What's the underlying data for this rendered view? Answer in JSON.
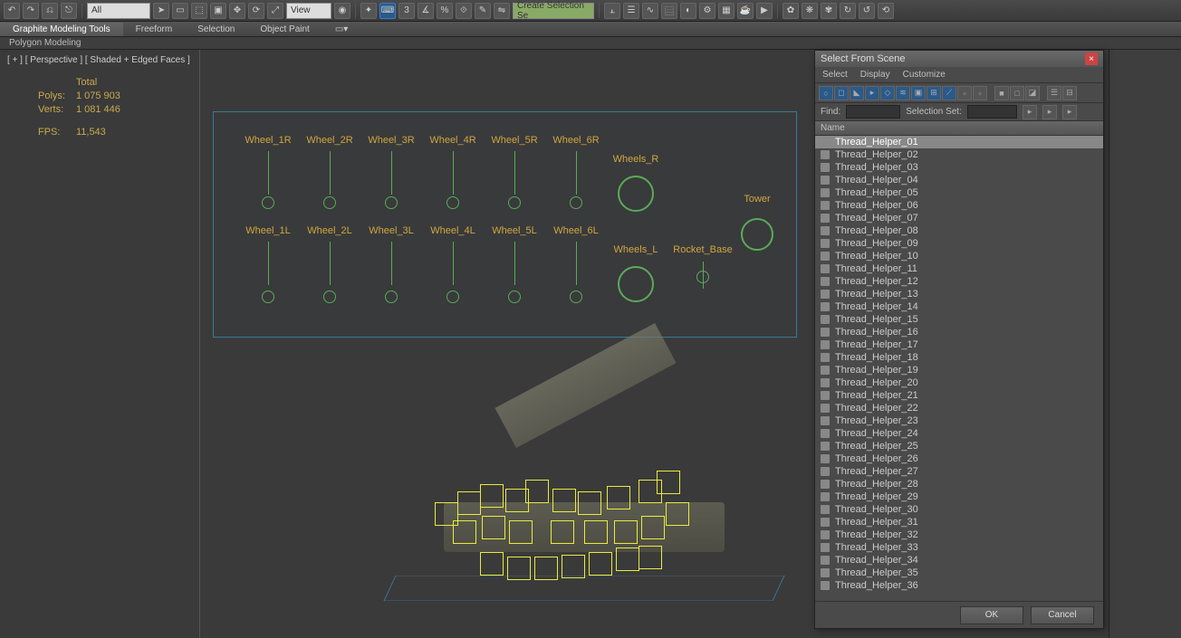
{
  "toolbar": {
    "dropdown_all": "All",
    "dropdown_view": "View",
    "selection_set_ph": "Create Selection Se"
  },
  "ribbon": {
    "tabs": [
      "Graphite Modeling Tools",
      "Freeform",
      "Selection",
      "Object Paint"
    ],
    "sub": "Polygon Modeling"
  },
  "viewport": {
    "label": "[ + ] [ Perspective ] [ Shaded + Edged Faces ]",
    "stats_header": "Total",
    "polys_label": "Polys:",
    "polys_value": "1 075 903",
    "verts_label": "Verts:",
    "verts_value": "1 081 446",
    "fps_label": "FPS:",
    "fps_value": "11,543"
  },
  "rig": {
    "rowR": [
      "Wheel_1R",
      "Wheel_2R",
      "Wheel_3R",
      "Wheel_4R",
      "Wheel_5R",
      "Wheel_6R"
    ],
    "rowL": [
      "Wheel_1L",
      "Wheel_2L",
      "Wheel_3L",
      "Wheel_4L",
      "Wheel_5L",
      "Wheel_6L"
    ],
    "wheels_r": "Wheels_R",
    "wheels_l": "Wheels_L",
    "tower": "Tower",
    "rocket": "Rocket_Base"
  },
  "dialog": {
    "title": "Select From Scene",
    "menu": [
      "Select",
      "Display",
      "Customize"
    ],
    "find_label": "Find:",
    "selset_label": "Selection Set:",
    "col_name": "Name",
    "ok": "OK",
    "cancel": "Cancel",
    "items": [
      "Thread_Helper_01",
      "Thread_Helper_02",
      "Thread_Helper_03",
      "Thread_Helper_04",
      "Thread_Helper_05",
      "Thread_Helper_06",
      "Thread_Helper_07",
      "Thread_Helper_08",
      "Thread_Helper_09",
      "Thread_Helper_10",
      "Thread_Helper_11",
      "Thread_Helper_12",
      "Thread_Helper_13",
      "Thread_Helper_14",
      "Thread_Helper_15",
      "Thread_Helper_16",
      "Thread_Helper_17",
      "Thread_Helper_18",
      "Thread_Helper_19",
      "Thread_Helper_20",
      "Thread_Helper_21",
      "Thread_Helper_22",
      "Thread_Helper_23",
      "Thread_Helper_24",
      "Thread_Helper_25",
      "Thread_Helper_26",
      "Thread_Helper_27",
      "Thread_Helper_28",
      "Thread_Helper_29",
      "Thread_Helper_30",
      "Thread_Helper_31",
      "Thread_Helper_32",
      "Thread_Helper_33",
      "Thread_Helper_34",
      "Thread_Helper_35",
      "Thread_Helper_36"
    ]
  }
}
